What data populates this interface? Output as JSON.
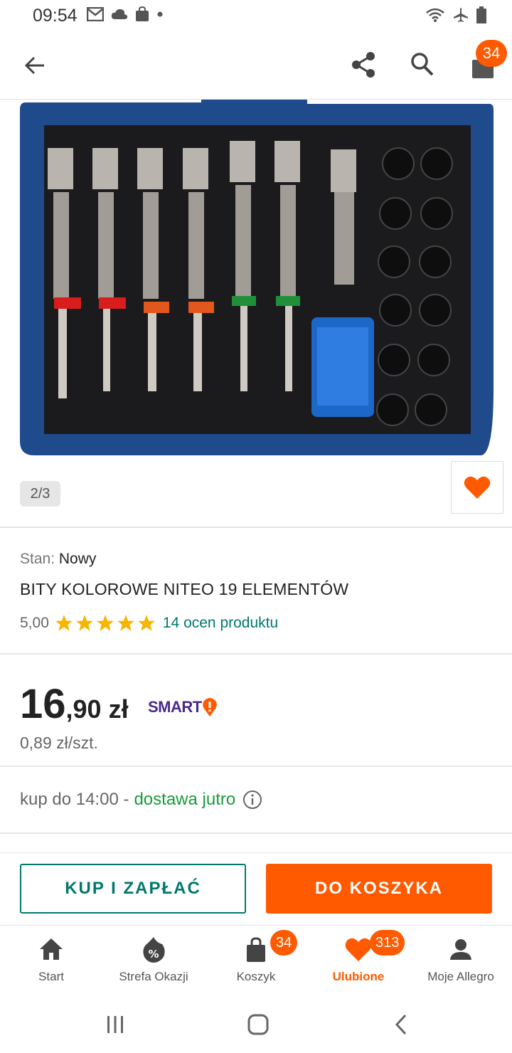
{
  "status_bar": {
    "time": "09:54"
  },
  "header": {
    "cart_badge": "34"
  },
  "image": {
    "counter": "2/3"
  },
  "product": {
    "condition_label": "Stan:",
    "condition_value": "Nowy",
    "title": "BITY KOLOROWE NITEO 19 ELEMENTÓW",
    "rating_value": "5,00",
    "rating_stars": 5,
    "rating_link": "14 ocen produktu",
    "price_int": "16",
    "price_dec": ",90",
    "price_currency": "zł",
    "smart_label": "SMART",
    "unit_price": "0,89 zł/szt.",
    "delivery_prefix": "kup do 14:00 -",
    "delivery_highlight": "dostawa jutro"
  },
  "actions": {
    "buy_label": "KUP I ZAPŁAĆ",
    "add_to_cart_label": "DO KOSZYKA"
  },
  "bottom_nav": {
    "items": [
      {
        "label": "Start"
      },
      {
        "label": "Strefa Okazji"
      },
      {
        "label": "Koszyk",
        "badge": "34"
      },
      {
        "label": "Ulubione",
        "badge": "313"
      },
      {
        "label": "Moje Allegro"
      }
    ]
  },
  "colors": {
    "accent": "#ff5a00",
    "teal": "#00796b",
    "green": "#1a9b3a",
    "star": "#f7b500"
  }
}
